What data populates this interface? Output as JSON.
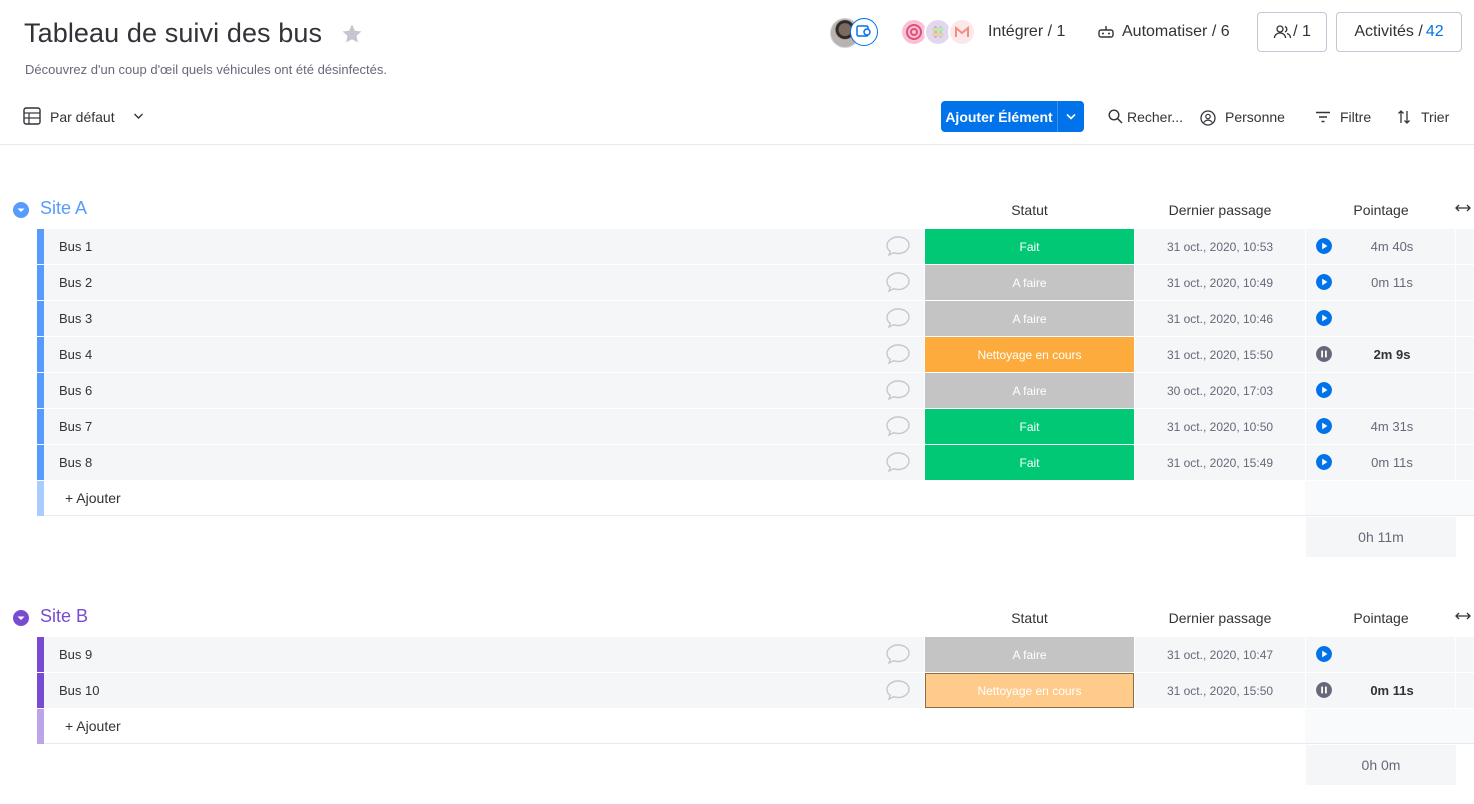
{
  "header": {
    "title": "Tableau de suivi des bus",
    "subtitle": "Découvrez d'un coup d'œil quels véhicules ont été désinfectés.",
    "integrate_label": "Intégrer / 1",
    "automate_label": "Automatiser / 6",
    "members_count": "/ 1",
    "activity_label": "Activités /",
    "activity_count": "42"
  },
  "toolbar": {
    "view_label": "Par défaut",
    "add_item_label": "Ajouter Élément",
    "search_label": "Recher...",
    "person_label": "Personne",
    "filter_label": "Filtre",
    "sort_label": "Trier"
  },
  "columns": {
    "status": "Statut",
    "last_pass": "Dernier passage",
    "timer": "Pointage"
  },
  "colors": {
    "done": "#00c875",
    "todo": "#c4c4c4",
    "working": "#fdab3d",
    "working_light": "#fecb8b",
    "group_a": "#579bfc",
    "group_b": "#784bd1",
    "timer_play": "#0073ea",
    "timer_pause": "#676879"
  },
  "groups": [
    {
      "name": "Site A",
      "add_label": "+ Ajouter",
      "sum": "0h 11m",
      "rows": [
        {
          "name": "Bus 1",
          "status": "Fait",
          "date": "31 oct., 2020, 10:53",
          "timer_state": "play",
          "timer": "4m 40s"
        },
        {
          "name": "Bus 2",
          "status": "A faire",
          "date": "31 oct., 2020, 10:49",
          "timer_state": "play",
          "timer": "0m 11s"
        },
        {
          "name": "Bus 3",
          "status": "A faire",
          "date": "31 oct., 2020, 10:46",
          "timer_state": "play",
          "timer": ""
        },
        {
          "name": "Bus 4",
          "status": "Nettoyage en cours",
          "date": "31 oct., 2020, 15:50",
          "timer_state": "pause",
          "timer": "2m 9s"
        },
        {
          "name": "Bus 6",
          "status": "A faire",
          "date": "30 oct., 2020, 17:03",
          "timer_state": "play",
          "timer": ""
        },
        {
          "name": "Bus 7",
          "status": "Fait",
          "date": "31 oct., 2020, 10:50",
          "timer_state": "play",
          "timer": "4m 31s"
        },
        {
          "name": "Bus 8",
          "status": "Fait",
          "date": "31 oct., 2020, 15:49",
          "timer_state": "play",
          "timer": "0m 11s"
        }
      ]
    },
    {
      "name": "Site B",
      "add_label": "+ Ajouter",
      "sum": "0h 0m",
      "rows": [
        {
          "name": "Bus 9",
          "status": "A faire",
          "date": "31 oct., 2020, 10:47",
          "timer_state": "play",
          "timer": ""
        },
        {
          "name": "Bus 10",
          "status": "Nettoyage en cours",
          "date": "31 oct., 2020, 15:50",
          "timer_state": "pause",
          "timer": "0m 11s",
          "highlight": true
        }
      ]
    }
  ]
}
